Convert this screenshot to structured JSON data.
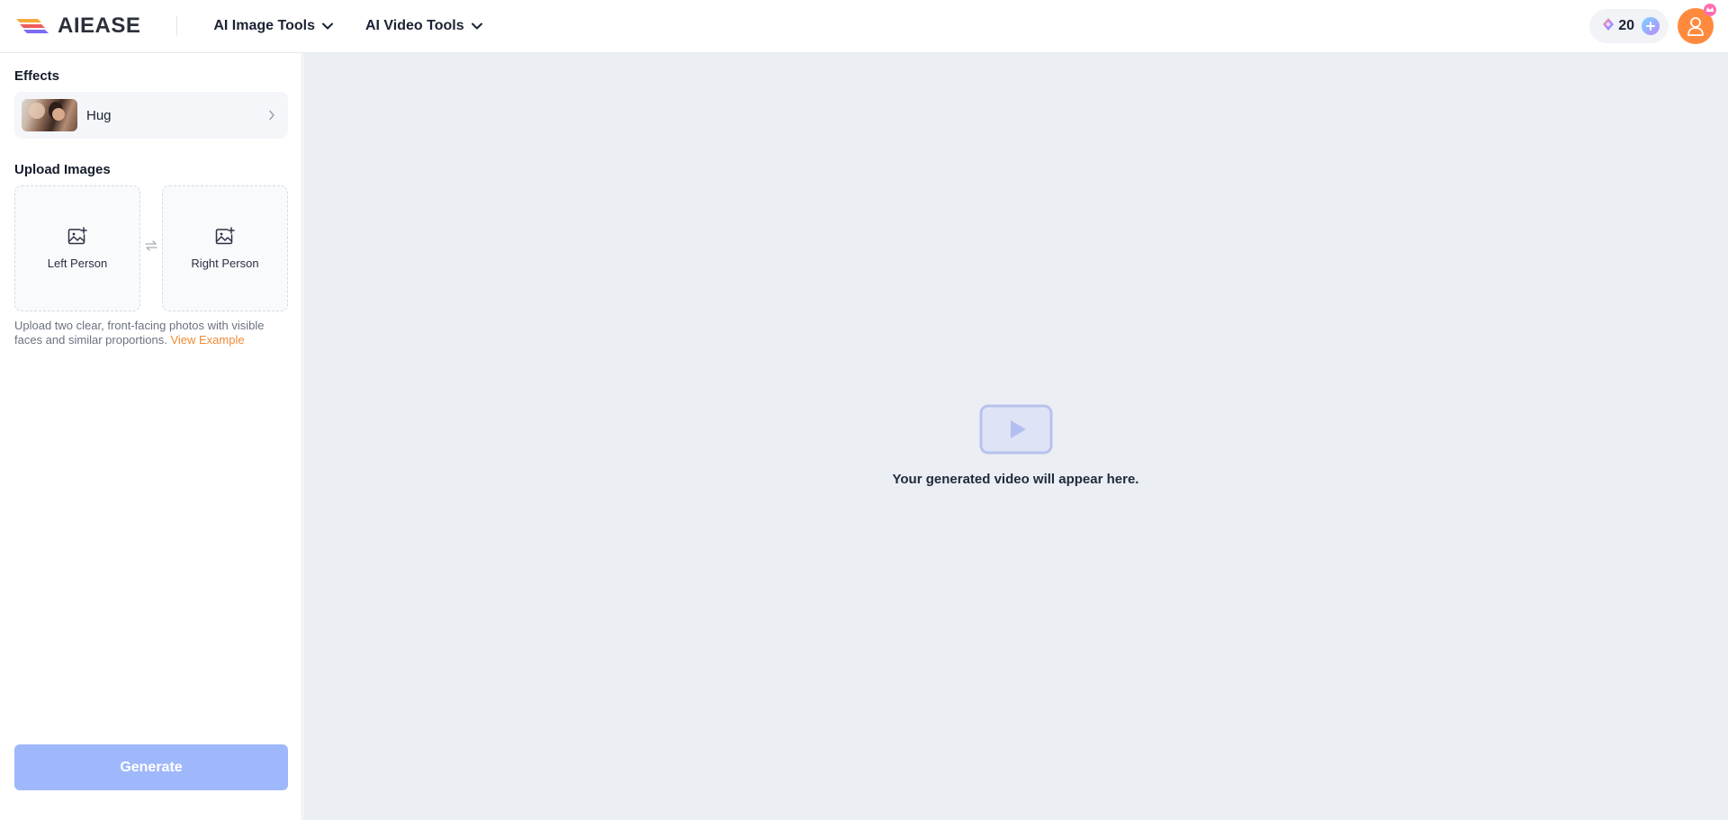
{
  "header": {
    "brand": "AIEASE",
    "nav": [
      {
        "label": "AI Image Tools"
      },
      {
        "label": "AI Video Tools"
      }
    ],
    "credits": "20"
  },
  "sidebar": {
    "effects_title": "Effects",
    "effect": {
      "name": "Hug"
    },
    "upload_title": "Upload Images",
    "upload": {
      "left_label": "Left Person",
      "right_label": "Right Person"
    },
    "hint_text": "Upload two clear, front-facing photos with visible faces and similar proportions.",
    "hint_link": "View Example",
    "generate_label": "Generate"
  },
  "main": {
    "placeholder_text": "Your generated video will appear here."
  },
  "colors": {
    "accent": "#f08a35",
    "generate_bg": "#9fb8fb",
    "avatar_bg": "#ff8a3d",
    "main_bg": "#ebeef3"
  },
  "icons": {
    "logo": "aiease-logo-icon",
    "nav_chevron": "chevron-down-icon",
    "credits": "gem-icon",
    "add_credits": "plus-icon",
    "avatar": "user-icon",
    "effect_arrow": "chevron-right-icon",
    "upload": "image-add-icon",
    "swap": "swap-icon",
    "video": "video-play-icon"
  }
}
